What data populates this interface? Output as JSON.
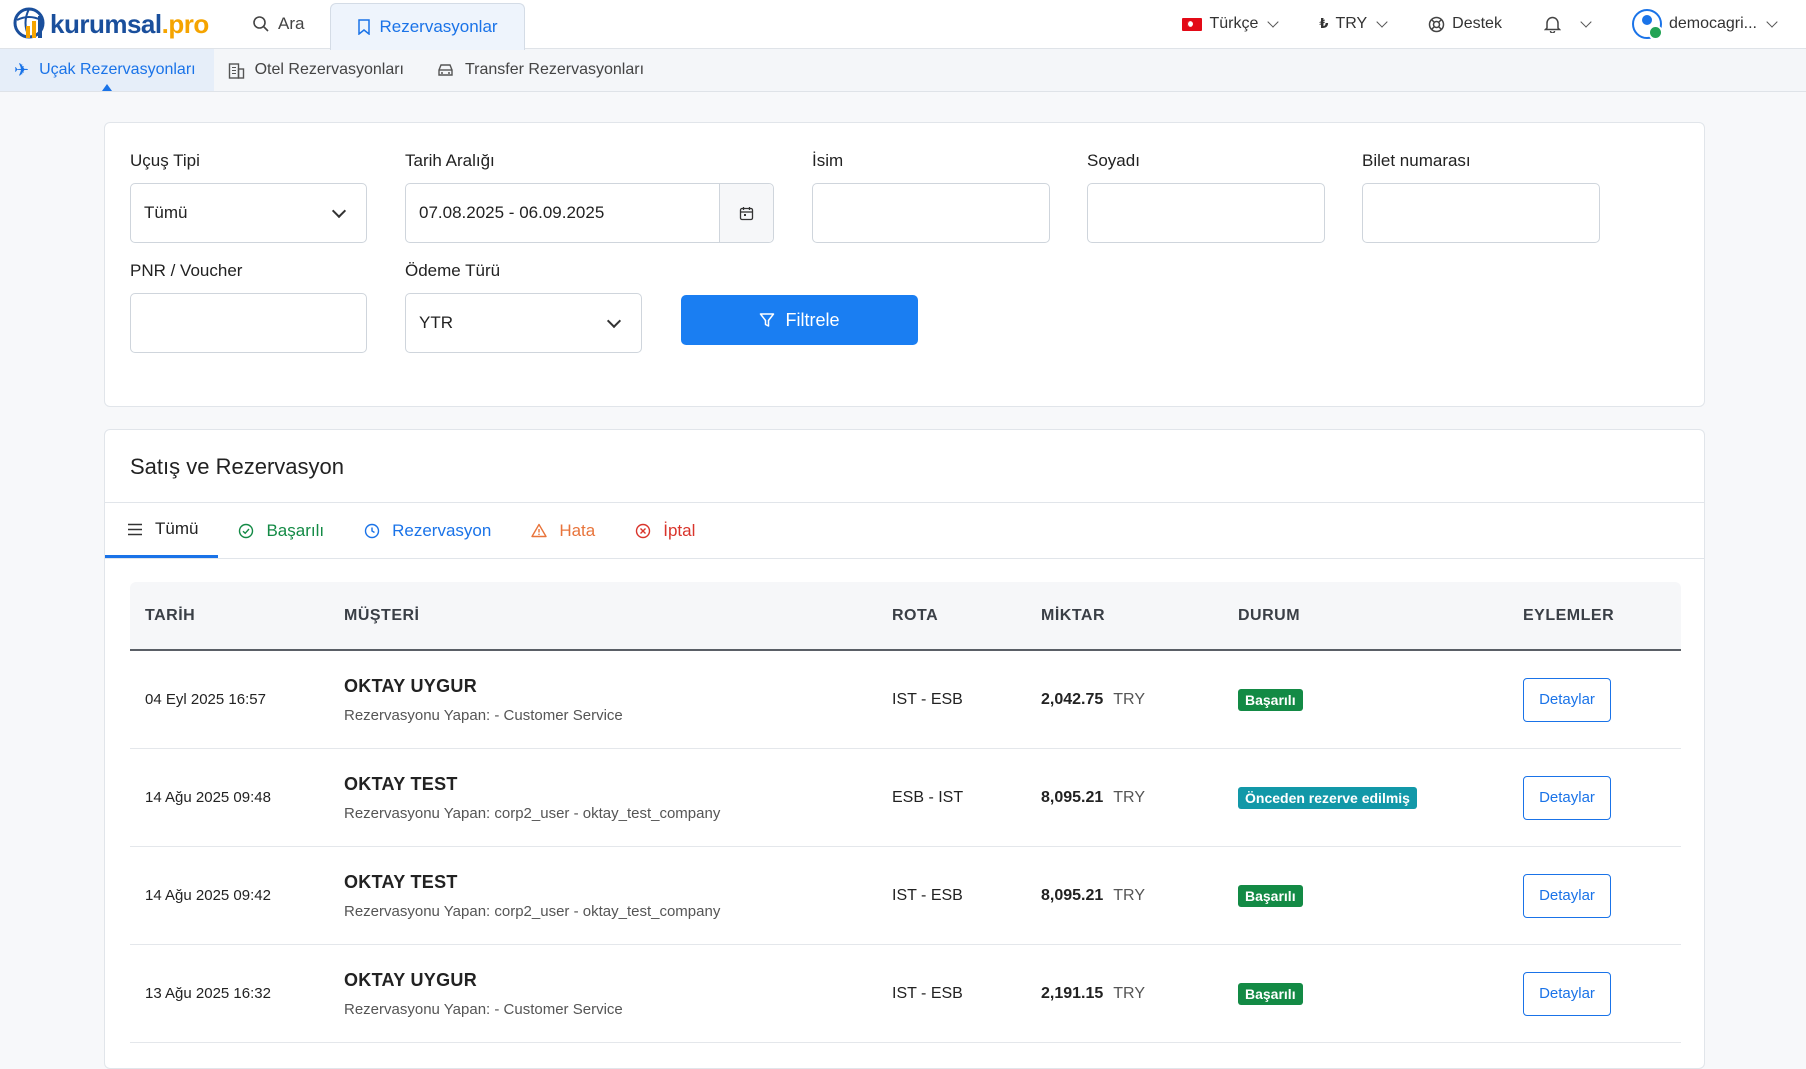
{
  "brand": {
    "main": "kurumsal",
    "suffix": ".pro"
  },
  "nav": {
    "search": "Ara",
    "bookings": "Rezervasyonlar",
    "language": "Türkçe",
    "currency": "TRY",
    "support": "Destek",
    "user": "democagri..."
  },
  "subnav": {
    "flight": "Uçak Rezervasyonları",
    "hotel": "Otel Rezervasyonları",
    "transfer": "Transfer Rezervasyonları"
  },
  "filters": {
    "flight_type_label": "Uçuş Tipi",
    "flight_type_value": "Tümü",
    "date_label": "Tarih Aralığı",
    "date_value": "07.08.2025 - 06.09.2025",
    "name_label": "İsim",
    "surname_label": "Soyadı",
    "ticket_label": "Bilet numarası",
    "pnr_label": "PNR / Voucher",
    "payment_label": "Ödeme Türü",
    "payment_value": "YTR",
    "submit": "Filtrele"
  },
  "list": {
    "title": "Satış ve Rezervasyon",
    "tabs": [
      {
        "label": "Tümü",
        "color": "#222222"
      },
      {
        "label": "Başarılı",
        "color": "#138a45"
      },
      {
        "label": "Rezervasyon",
        "color": "#1a73e8"
      },
      {
        "label": "Hata",
        "color": "#e8743b"
      },
      {
        "label": "İptal",
        "color": "#d9342b"
      }
    ],
    "columns": [
      "TARİH",
      "MÜŞTERİ",
      "ROTA",
      "MİKTAR",
      "DURUM",
      "EYLEMLER"
    ],
    "rows": [
      {
        "date": "04 Eyl 2025 16:57",
        "name": "OKTAY UYGUR",
        "by": "Rezervasyonu Yapan: - Customer Service",
        "route": "IST - ESB",
        "amount": "2,042.75",
        "currency": "TRY",
        "status": "Başarılı",
        "action": "Detaylar"
      },
      {
        "date": "14 Ağu 2025 09:48",
        "name": "OKTAY TEST",
        "by": "Rezervasyonu Yapan: corp2_user - oktay_test_company",
        "route": "ESB - IST",
        "amount": "8,095.21",
        "currency": "TRY",
        "status": "Önceden rezerve edilmiş",
        "action": "Detaylar"
      },
      {
        "date": "14 Ağu 2025 09:42",
        "name": "OKTAY TEST",
        "by": "Rezervasyonu Yapan: corp2_user - oktay_test_company",
        "route": "IST - ESB",
        "amount": "8,095.21",
        "currency": "TRY",
        "status": "Başarılı",
        "action": "Detaylar"
      },
      {
        "date": "13 Ağu 2025 16:32",
        "name": "OKTAY UYGUR",
        "by": "Rezervasyonu Yapan: - Customer Service",
        "route": "IST - ESB",
        "amount": "2,191.15",
        "currency": "TRY",
        "status": "Başarılı",
        "action": "Detaylar"
      }
    ]
  },
  "colors": {
    "accent": "#1a73e8",
    "primary_button": "#1a7ef2",
    "success": "#138a45",
    "prebooked": "#1298a8"
  }
}
